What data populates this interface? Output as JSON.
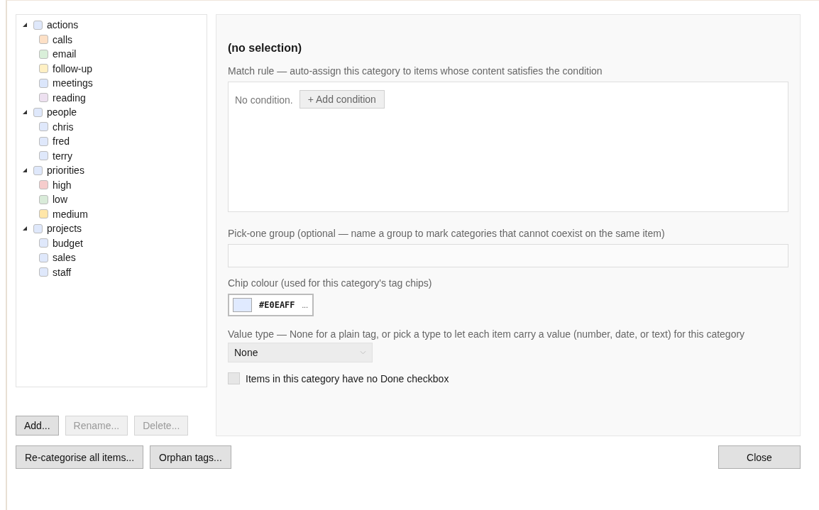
{
  "tree": [
    {
      "label": "actions",
      "color": "#dfe8fb",
      "expanded": true,
      "children": [
        {
          "label": "calls",
          "color": "#fde0c6"
        },
        {
          "label": "email",
          "color": "#d9efd9"
        },
        {
          "label": "follow-up",
          "color": "#fff0c4"
        },
        {
          "label": "meetings",
          "color": "#dbe6fb"
        },
        {
          "label": "reading",
          "color": "#ede0f0"
        }
      ]
    },
    {
      "label": "people",
      "color": "#dfe8fb",
      "expanded": true,
      "children": [
        {
          "label": "chris",
          "color": "#dfe8fb"
        },
        {
          "label": "fred",
          "color": "#dfe8fb"
        },
        {
          "label": "terry",
          "color": "#dfe8fb"
        }
      ]
    },
    {
      "label": "priorities",
      "color": "#dfe8fb",
      "expanded": true,
      "children": [
        {
          "label": "high",
          "color": "#f6cccc"
        },
        {
          "label": "low",
          "color": "#d9ebd9"
        },
        {
          "label": "medium",
          "color": "#ffe6a8"
        }
      ]
    },
    {
      "label": "projects",
      "color": "#dfe8fb",
      "expanded": true,
      "children": [
        {
          "label": "budget",
          "color": "#dfe8fb"
        },
        {
          "label": "sales",
          "color": "#dfe8fb"
        },
        {
          "label": "staff",
          "color": "#dfe8fb"
        }
      ]
    }
  ],
  "tree_buttons": [
    {
      "label": "Add...",
      "disabled": false
    },
    {
      "label": "Rename...",
      "disabled": true
    },
    {
      "label": "Delete...",
      "disabled": true
    }
  ],
  "detail": {
    "title": "(no selection)",
    "match_rule": {
      "label": "Match rule — auto-assign this category to items whose content satisfies the condition",
      "empty_text": "No condition.",
      "add_button": "+ Add condition"
    },
    "pick_one": {
      "label": "Pick-one group (optional — name a group to mark categories that cannot coexist on the same item)"
    },
    "chip": {
      "label": "Chip colour (used for this category's tag chips)",
      "value": "#E0EAFF",
      "more": "..."
    },
    "value_type": {
      "label": "Value type — None for a plain tag, or pick a type to let each item carry a value (number, date, or text) for this category",
      "value": "None"
    },
    "no_done": {
      "label": "Items in this category have no Done checkbox",
      "checked": false
    }
  },
  "bottom_buttons": [
    {
      "label": "Re-categorise all items..."
    },
    {
      "label": "Orphan tags..."
    }
  ],
  "close_button": "Close"
}
